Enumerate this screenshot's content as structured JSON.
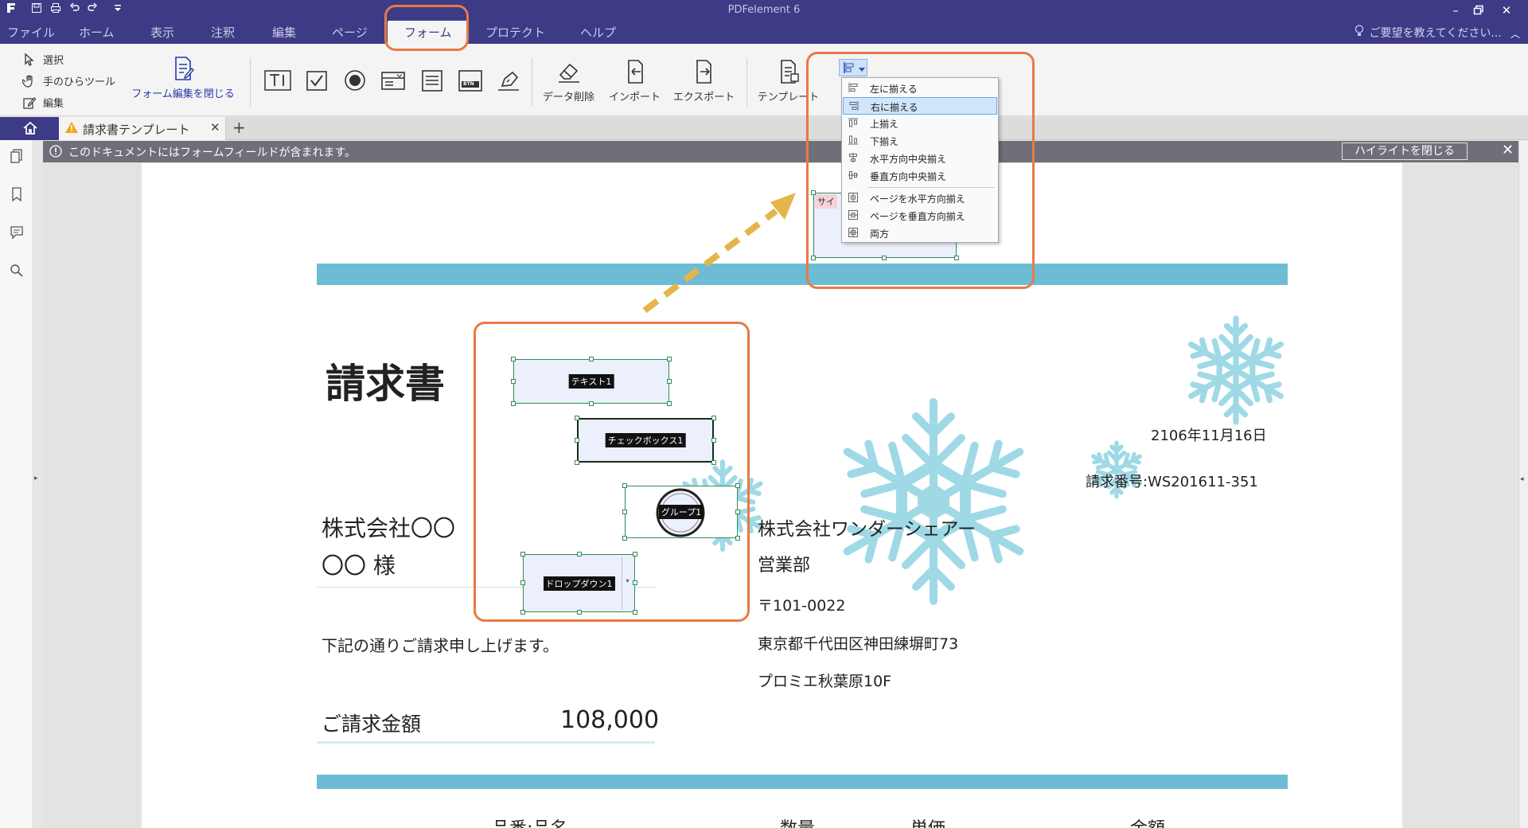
{
  "app": {
    "title": "PDFelement 6",
    "help_search_placeholder": "ご要望を教えてください..."
  },
  "menu": {
    "items": [
      "ファイル",
      "ホーム",
      "表示",
      "注釈",
      "編集",
      "ページ",
      "フォーム",
      "プロテクト",
      "ヘルプ"
    ],
    "active": "フォーム"
  },
  "ribbon": {
    "select": "選択",
    "hand_tool": "手のひらツール",
    "edit": "編集",
    "close_form_edit": "フォーム編集を閉じる",
    "delete_data": "データ削除",
    "import": "インポート",
    "export": "エクスポート",
    "template": "テンプレート",
    "button_field_icon_text": "BTN"
  },
  "tabs": {
    "document_tab": "請求書テンプレート"
  },
  "notice": {
    "message": "このドキュメントにはフォームフィールドが含まれます。",
    "close_highlight": "ハイライトを閉じる"
  },
  "align_menu": {
    "items": [
      "左に揃える",
      "右に揃える",
      "上揃え",
      "下揃え",
      "水平方向中央揃え",
      "垂直方向中央揃え",
      "ページを水平方向揃え",
      "ページを垂直方向揃え",
      "両方"
    ],
    "selected": "右に揃える"
  },
  "invoice": {
    "title": "請求書",
    "date": "2106年11月16日",
    "invoice_number": "請求番号:WS201611-351",
    "client_company": "株式会社〇〇",
    "client_name": "〇〇 様",
    "intro": "下記の通りご請求申し上げます。",
    "amount_label": "ご請求金額",
    "amount_value": "108,000",
    "sender_company": "株式会社ワンダーシェアー",
    "sender_dept": "営業部",
    "postal": "〒101-0022",
    "address1": "東京都千代田区神田練塀町73",
    "address2": "プロミエ秋葉原10F",
    "columns": [
      "品番:品名",
      "数量",
      "単価",
      "金額"
    ],
    "top_field_label_fragment": "サイ"
  },
  "form_fields": {
    "text": "テキスト1",
    "checkbox": "チェックボックス1",
    "radio_group": "グループ1",
    "dropdown": "ドロップダウン1"
  },
  "colors": {
    "titlebar": "#3d3a86",
    "band": "#6dbcd3",
    "highlight_orange": "#e87a45",
    "field_border": "#2f8b59",
    "snowflake": "#9fd9e6",
    "arrow": "#e4b54a"
  }
}
